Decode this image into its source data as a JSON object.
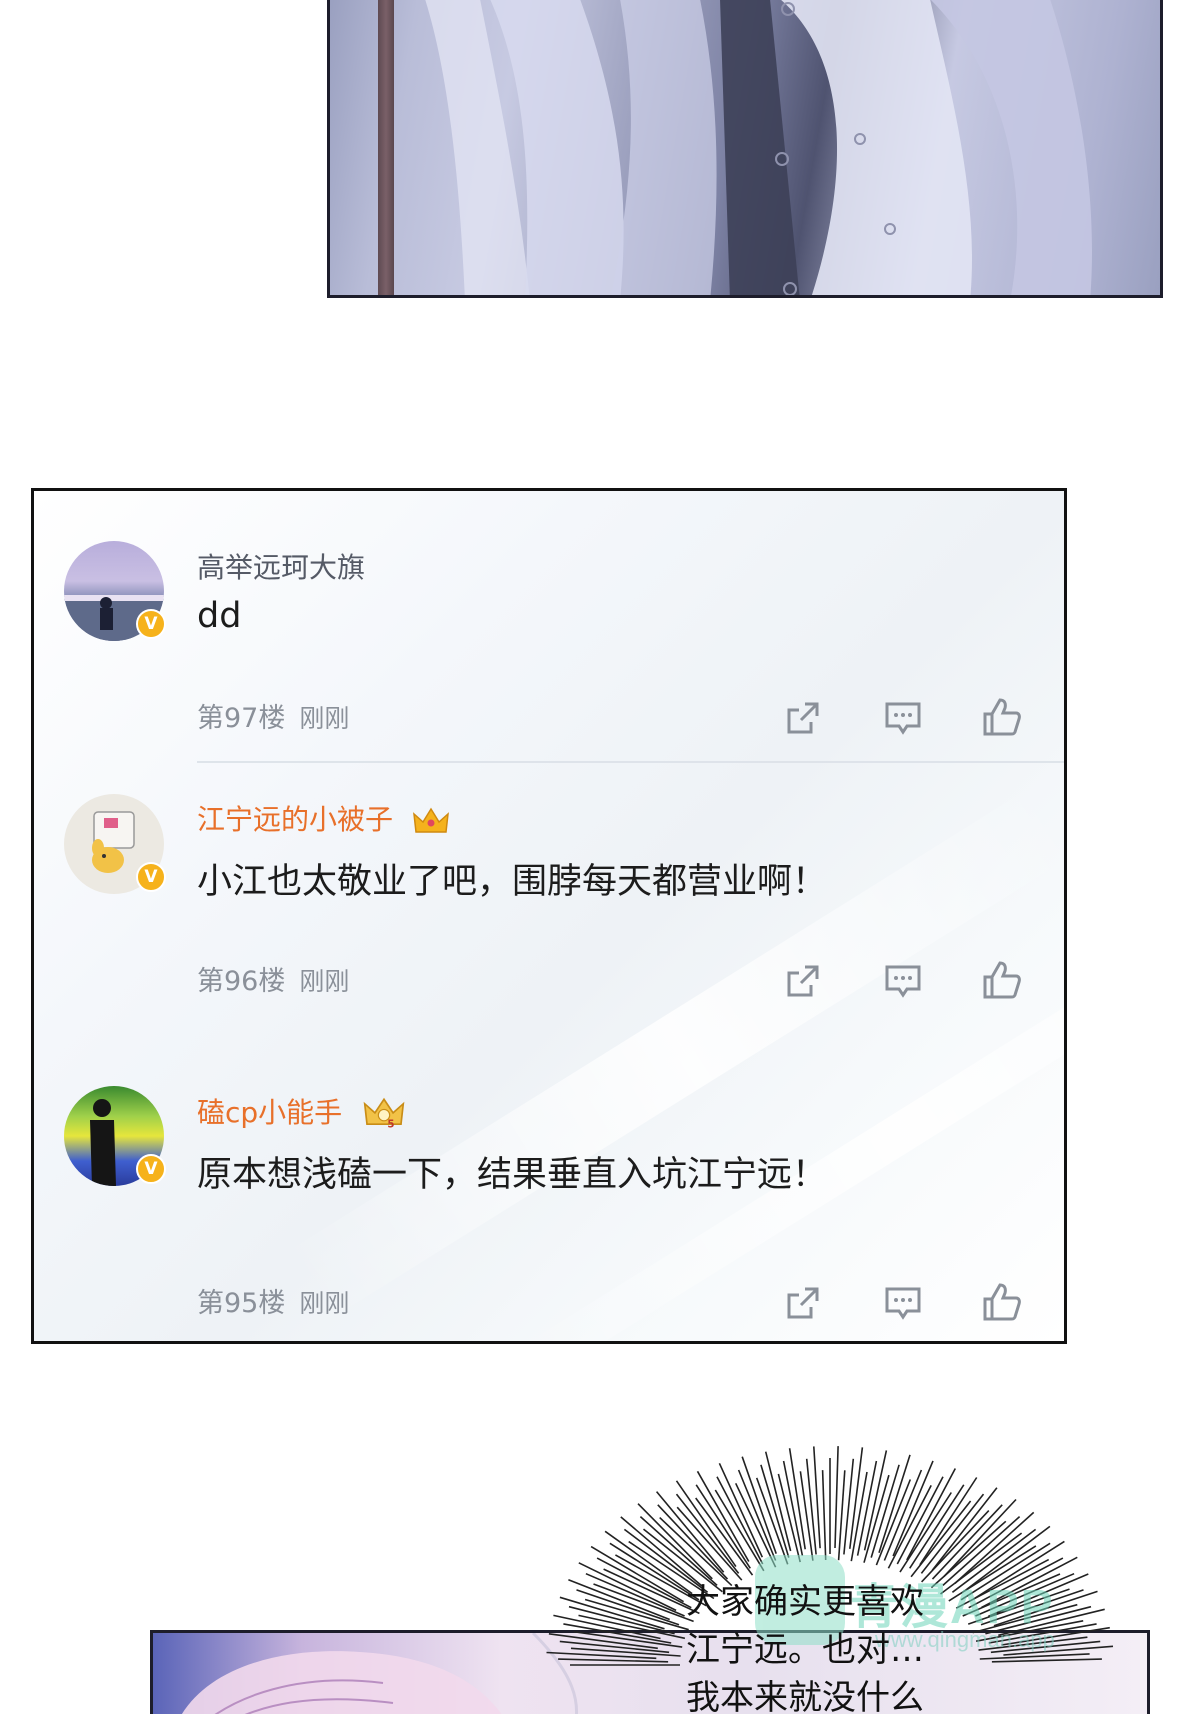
{
  "comments": [
    {
      "username": "高举远珂大旗",
      "vip": false,
      "text": "dd",
      "floor": "第97楼",
      "time": "刚刚",
      "verified_mark": "V"
    },
    {
      "username": "江宁远的小被子",
      "vip": true,
      "text": "小江也太敬业了吧，围脖每天都营业啊！",
      "floor": "第96楼",
      "time": "刚刚",
      "verified_mark": "V"
    },
    {
      "username": "磕cp小能手",
      "vip": true,
      "text": "原本想浅磕一下，结果垂直入坑江宁远！",
      "floor": "第95楼",
      "time": "刚刚",
      "verified_mark": "V"
    }
  ],
  "speech_bubble": {
    "lines": [
      "大家确实更喜欢",
      "江宁远。也对…",
      "我本来就没什么"
    ]
  },
  "watermark": {
    "title": "青漫APP",
    "url": "www.qingman.app"
  },
  "icons": {
    "share": "share-icon",
    "reply": "comment-icon",
    "like": "thumbs-up-icon",
    "verified": "verified-badge-icon",
    "crown": "crown-icon"
  },
  "colors": {
    "vip_name": "#e8702a",
    "normal_name": "#555a66",
    "badge": "#f6b21b"
  }
}
